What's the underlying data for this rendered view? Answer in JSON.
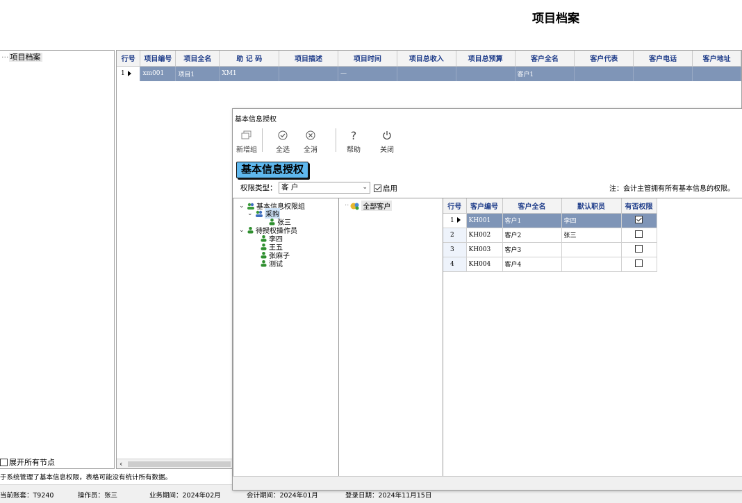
{
  "page_title": "项目档案",
  "left_tree": {
    "root_label": "项目档案",
    "expand_all_label": "展开所有节点"
  },
  "main_grid": {
    "headers": [
      "行号",
      "项目编号",
      "项目全名",
      "助 记 码",
      "项目描述",
      "项目时间",
      "项目总收入",
      "项目总预算",
      "客户全名",
      "客户代表",
      "客户电话",
      "客户地址"
    ],
    "rows": [
      {
        "row_no": "1",
        "code": "xm001",
        "name": "项目1",
        "mnemonic": "XM1",
        "desc": "",
        "time": "—",
        "income": "",
        "budget": "",
        "customer": "客户1",
        "rep": "",
        "phone": "",
        "addr": ""
      }
    ]
  },
  "status_message": "于系统管理了基本信息权限，表格可能没有统计所有数据。",
  "status_bar": {
    "account": "当前账套：T9240",
    "operator": "操作员：张三",
    "business_period": "业务期间：2024年02月",
    "accounting_period": "会计期间：2024年01月",
    "login_date": "登录日期：2024年11月15日"
  },
  "dialog": {
    "title": "基本信息授权",
    "toolbar": {
      "new_group": "新增组",
      "select_all": "全选",
      "clear_all": "全消",
      "help": "帮助",
      "close": "关闭"
    },
    "heading": "基本信息授权",
    "perm_type_label": "权限类型：",
    "perm_type_value": "客  户",
    "enable_label": "启用",
    "enable_checked": true,
    "note": "注：会计主管拥有所有基本信息的权限。",
    "tree": {
      "root": "基本信息权限组",
      "group_purchase": "采购",
      "member_zhangsan": "张三",
      "pending_group": "待授权操作员",
      "pending": [
        "李四",
        "王五",
        "张麻子",
        "测试"
      ]
    },
    "middle_node": "全部客户",
    "grid": {
      "headers": [
        "行号",
        "客户编号",
        "客户全名",
        "默认职员",
        "有否权限"
      ],
      "rows": [
        {
          "row_no": "1",
          "code": "KH001",
          "name": "客户1",
          "staff": "李四",
          "has_perm": true
        },
        {
          "row_no": "2",
          "code": "KH002",
          "name": "客户2",
          "staff": "张三",
          "has_perm": false
        },
        {
          "row_no": "3",
          "code": "KH003",
          "name": "客户3",
          "staff": "",
          "has_perm": false
        },
        {
          "row_no": "4",
          "code": "KH004",
          "name": "客户4",
          "staff": "",
          "has_perm": false
        }
      ]
    }
  },
  "colors": {
    "selection": "#7f95b7",
    "header_text": "#1f3d8a",
    "badge": "#5fb8ee"
  },
  "icons": [
    "new-group-icon",
    "select-all-icon",
    "clear-all-icon",
    "help-icon",
    "power-icon",
    "group-users-icon",
    "user-icon",
    "all-customers-icon"
  ]
}
